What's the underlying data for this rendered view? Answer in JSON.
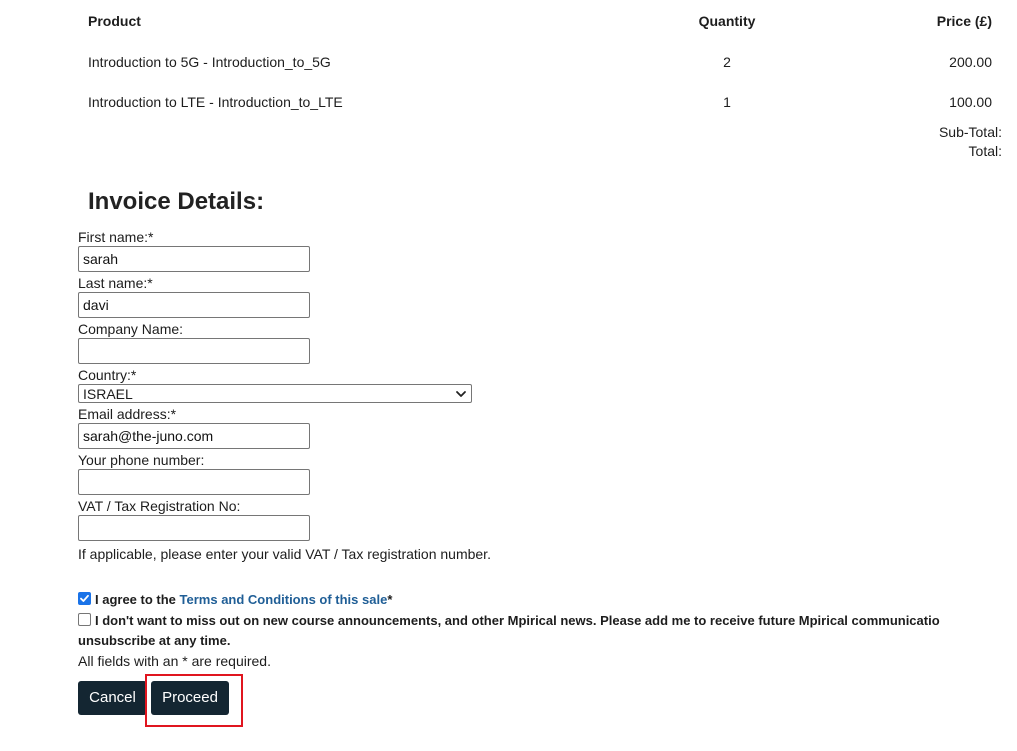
{
  "cart": {
    "headers": {
      "product": "Product",
      "quantity": "Quantity",
      "price": "Price (£)"
    },
    "items": [
      {
        "product": "Introduction to 5G - Introduction_to_5G",
        "quantity": "2",
        "price": "200.00"
      },
      {
        "product": "Introduction to LTE - Introduction_to_LTE",
        "quantity": "1",
        "price": "100.00"
      }
    ],
    "subtotal_label": "Sub-Total:",
    "total_label": "Total:"
  },
  "invoice": {
    "title": "Invoice Details:",
    "first_name": {
      "label": "First name:*",
      "value": "sarah"
    },
    "last_name": {
      "label": "Last name:*",
      "value": "davi"
    },
    "company": {
      "label": "Company Name:",
      "value": ""
    },
    "country": {
      "label": "Country:*",
      "value": "ISRAEL"
    },
    "email": {
      "label": "Email address:*",
      "value": "sarah@the-juno.com"
    },
    "phone": {
      "label": "Your phone number:",
      "value": ""
    },
    "vat": {
      "label": "VAT / Tax Registration No:",
      "value": "",
      "help": "If applicable, please enter your valid VAT / Tax registration number."
    },
    "agree": {
      "prefix": "I agree to the ",
      "link": "Terms and Conditions of this sale",
      "suffix": "*",
      "checked": true
    },
    "newsletter": {
      "line1": "I don't want to miss out on new course announcements, and other Mpirical news. Please add me to receive future Mpirical communicatio",
      "line2": "unsubscribe at any time.",
      "checked": false
    },
    "required_note": "All fields with an * are required."
  },
  "actions": {
    "cancel_label": "Cancel",
    "proceed_label": "Proceed"
  },
  "colors": {
    "button_bg": "#142632",
    "link": "#1f5e96",
    "highlight": "#e0151f",
    "checkbox_checked": "#1a73e8"
  }
}
